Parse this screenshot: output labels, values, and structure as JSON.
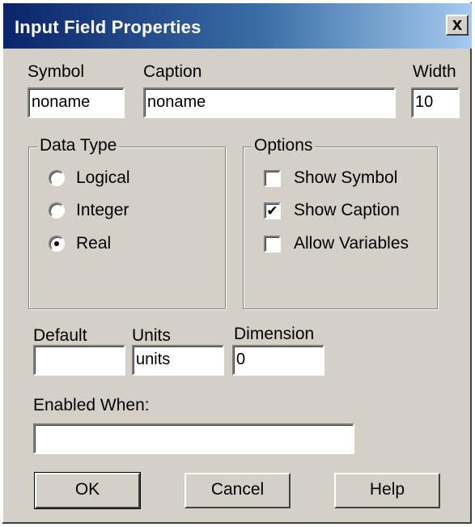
{
  "window": {
    "title": "Input Field Properties",
    "close_glyph": "x"
  },
  "symbol": {
    "label": "Symbol",
    "value": "noname"
  },
  "caption": {
    "label": "Caption",
    "value": "noname"
  },
  "width": {
    "label": "Width",
    "value": "10"
  },
  "data_type": {
    "title": "Data Type",
    "options": [
      "Logical",
      "Integer",
      "Real"
    ],
    "selected": "Real"
  },
  "options_group": {
    "title": "Options",
    "items": [
      {
        "label": "Show Symbol",
        "checked": false
      },
      {
        "label": "Show Caption",
        "checked": true
      },
      {
        "label": "Allow Variables",
        "checked": false
      }
    ]
  },
  "default_field": {
    "label": "Default",
    "value": ""
  },
  "units_field": {
    "label": "Units",
    "value": "units"
  },
  "dimension_field": {
    "label": "Dimension",
    "value": "0"
  },
  "enabled_when": {
    "label": "Enabled When:",
    "value": ""
  },
  "buttons": {
    "ok": "OK",
    "cancel": "Cancel",
    "help": "Help"
  },
  "colors": {
    "titlebar_start": "#0a246a",
    "titlebar_end": "#a6caf0",
    "dialog_face": "#d4d0c8"
  },
  "icons": {
    "check": "check-mark-icon"
  }
}
